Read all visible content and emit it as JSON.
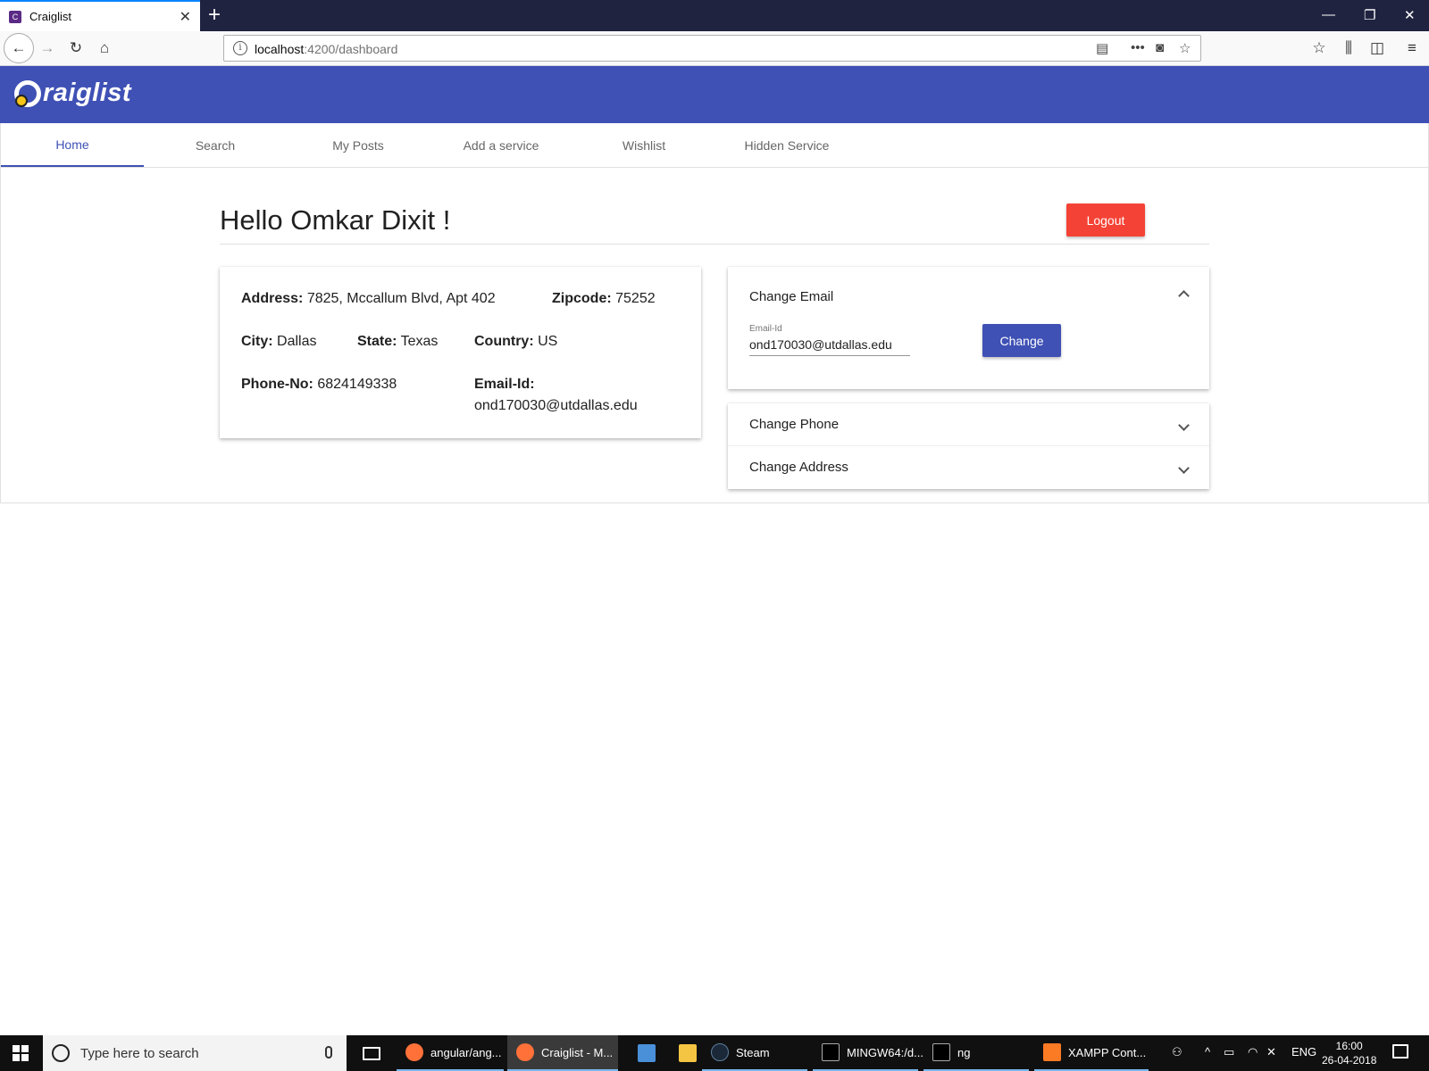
{
  "browser": {
    "tab_title": "Craiglist",
    "tab_favicon": "C",
    "url_host": "localhost",
    "url_rest": ":4200/dashboard"
  },
  "app": {
    "logo_text": "raiglist"
  },
  "nav_tabs": [
    {
      "label": "Home",
      "active": true
    },
    {
      "label": "Search",
      "active": false
    },
    {
      "label": "My Posts",
      "active": false
    },
    {
      "label": "Add a service",
      "active": false
    },
    {
      "label": "Wishlist",
      "active": false
    },
    {
      "label": "Hidden Service",
      "active": false
    }
  ],
  "profile": {
    "greeting": "Hello Omkar Dixit !",
    "logout_label": "Logout",
    "address_label": "Address:",
    "address_value": "7825, Mccallum Blvd, Apt 402",
    "zipcode_label": "Zipcode:",
    "zipcode_value": "75252",
    "city_label": "City:",
    "city_value": "Dallas",
    "state_label": "State:",
    "state_value": "Texas",
    "country_label": "Country:",
    "country_value": "US",
    "phone_label": "Phone-No:",
    "phone_value": "6824149338",
    "email_label": "Email-Id:",
    "email_value": "ond170030@utdallas.edu"
  },
  "panels": {
    "email": {
      "title": "Change Email",
      "input_label": "Email-Id",
      "input_value": "ond170030@utdallas.edu",
      "button_label": "Change"
    },
    "phone_title": "Change Phone",
    "address_title": "Change Address"
  },
  "taskbar": {
    "search_placeholder": "Type here to search",
    "apps": [
      "angular/ang...",
      "Craiglist - M...",
      "Steam",
      "MINGW64:/d...",
      "ng",
      "XAMPP Cont..."
    ],
    "language": "ENG",
    "time": "16:00",
    "date": "26-04-2018"
  }
}
